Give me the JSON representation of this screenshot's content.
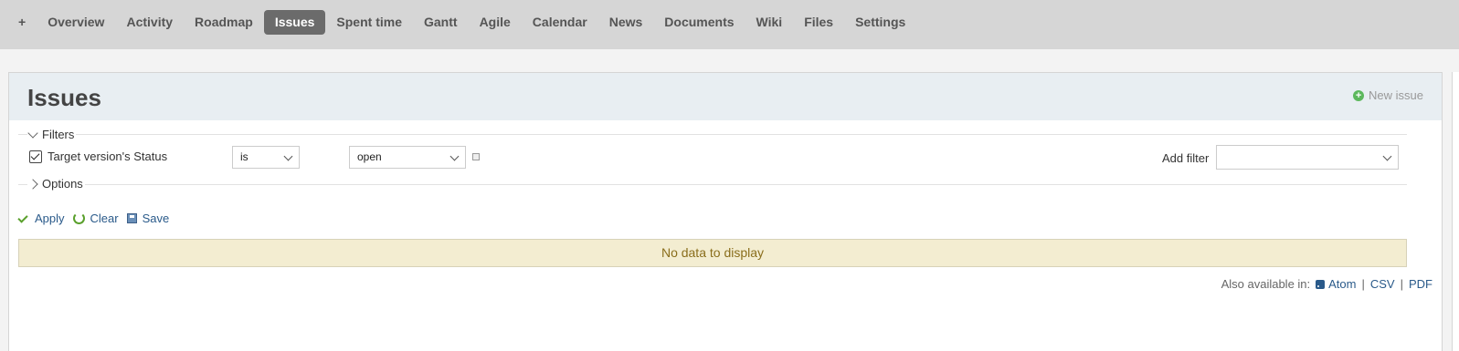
{
  "nav": {
    "items": [
      {
        "label": "+",
        "selected": false
      },
      {
        "label": "Overview",
        "selected": false
      },
      {
        "label": "Activity",
        "selected": false
      },
      {
        "label": "Roadmap",
        "selected": false
      },
      {
        "label": "Issues",
        "selected": true
      },
      {
        "label": "Spent time",
        "selected": false
      },
      {
        "label": "Gantt",
        "selected": false
      },
      {
        "label": "Agile",
        "selected": false
      },
      {
        "label": "Calendar",
        "selected": false
      },
      {
        "label": "News",
        "selected": false
      },
      {
        "label": "Documents",
        "selected": false
      },
      {
        "label": "Wiki",
        "selected": false
      },
      {
        "label": "Files",
        "selected": false
      },
      {
        "label": "Settings",
        "selected": false
      }
    ]
  },
  "page": {
    "title": "Issues",
    "new_issue_label": "New issue"
  },
  "filters": {
    "legend": "Filters",
    "row": {
      "label": "Target version's Status",
      "checked": true,
      "operator": "is",
      "value": "open"
    },
    "add_filter_label": "Add filter",
    "add_filter_value": ""
  },
  "options": {
    "legend": "Options"
  },
  "actions": {
    "apply": "Apply",
    "clear": "Clear",
    "save": "Save"
  },
  "results": {
    "nodata": "No data to display"
  },
  "formats": {
    "label": "Also available in:",
    "atom": "Atom",
    "csv": "CSV",
    "pdf": "PDF",
    "separator": "|"
  },
  "colors": {
    "nav_selected": "#6b6b6b",
    "nodata_bg": "#f3edd1",
    "link": "#2a5a8a",
    "icon_green": "#5aa02c"
  }
}
